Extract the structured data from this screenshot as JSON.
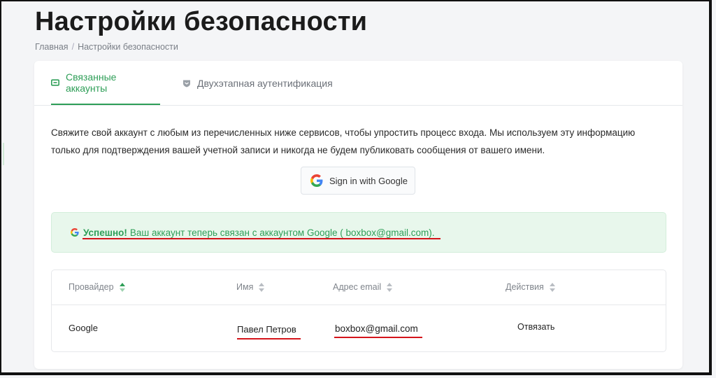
{
  "page": {
    "title": "Настройки безопасности",
    "breadcrumb": {
      "home": "Главная",
      "separator": "/",
      "current": "Настройки безопасности"
    }
  },
  "tabs": [
    {
      "label": "Связанные аккаунты",
      "icon": "link-icon",
      "active": true
    },
    {
      "label": "Двухэтапная аутентификация",
      "icon": "shield-icon",
      "active": false
    }
  ],
  "intro_text": "Свяжите свой аккаунт с любым из перечисленных ниже сервисов, чтобы упростить процесс входа. Мы используем эту информацию только для подтверждения вашей учетной записи и никогда не будем публиковать сообщения от вашего имени.",
  "google_button": {
    "label": "Sign in with Google",
    "icon": "google-icon"
  },
  "alert": {
    "icon": "google-icon",
    "strong": "Успешно!",
    "message": "Ваш аккаунт теперь связан с аккаунтом Google ( boxbox@gmail.com)."
  },
  "table": {
    "columns": [
      "Провайдер",
      "Имя",
      "Адрес email",
      "Действия"
    ],
    "rows": [
      {
        "provider": "Google",
        "name": "Павел Петров",
        "email": "boxbox@gmail.com",
        "action": "Отвязать"
      }
    ]
  },
  "colors": {
    "accent": "#2e9e57",
    "alert_bg": "#e8f7ec",
    "annotation": "#d4141b"
  }
}
